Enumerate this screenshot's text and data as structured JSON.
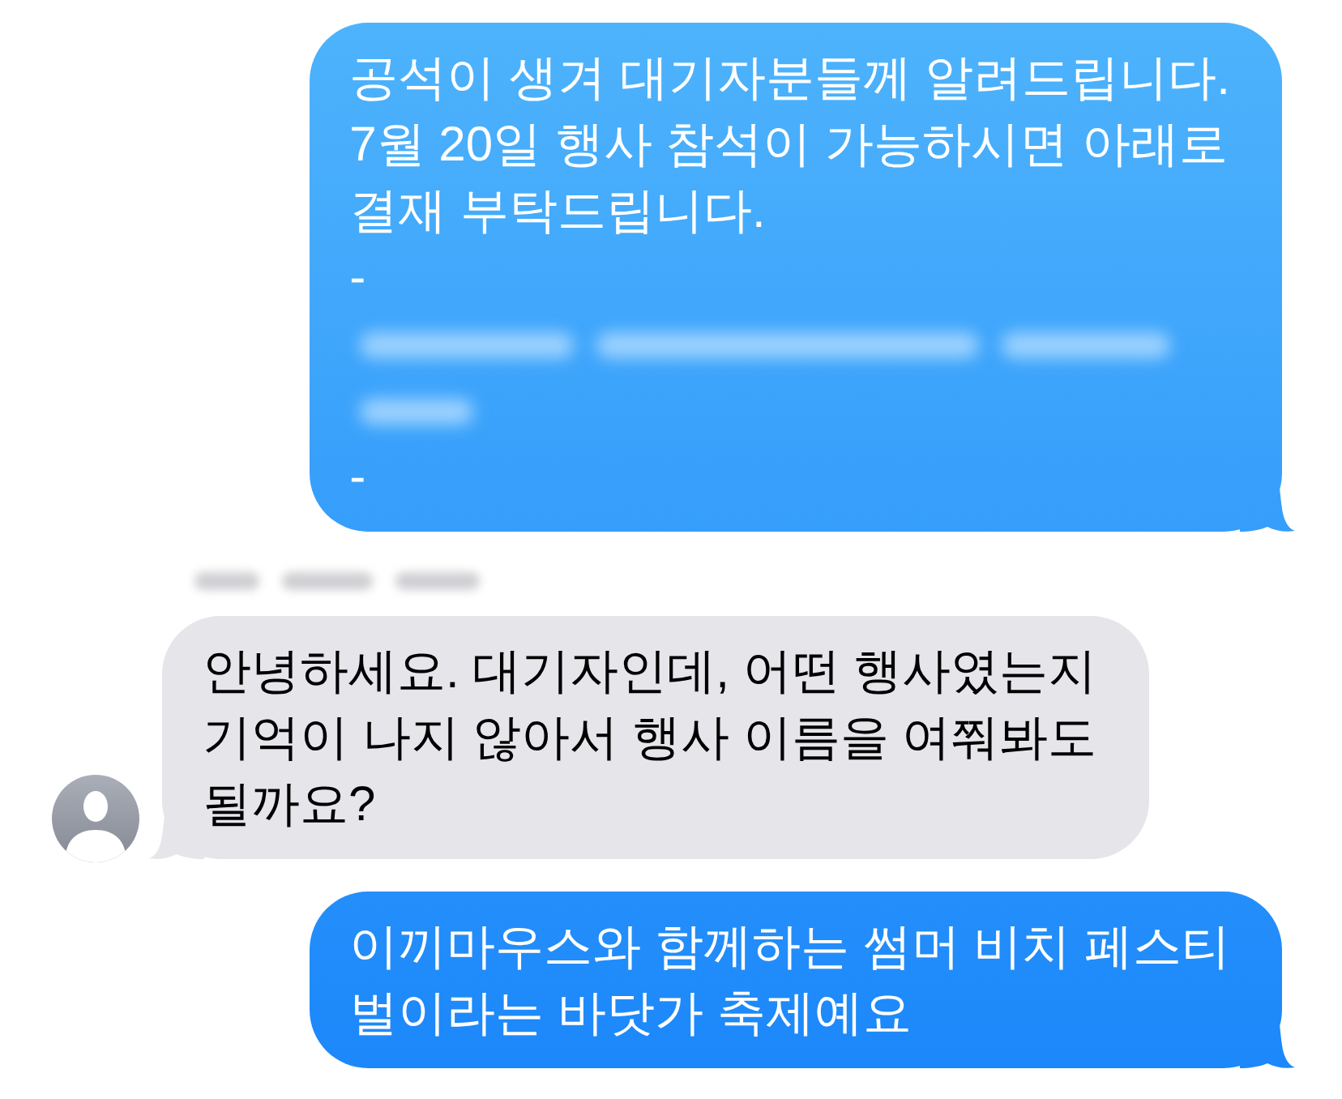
{
  "messages": [
    {
      "kind": "sent",
      "parts": [
        {
          "kind": "text",
          "text": "공석이 생겨 대기자분들께 알려드립니다.\n7월 20일 행사 참석이 가능하시면 아래로\n결재 부탁드립니다."
        },
        {
          "kind": "text",
          "text": "-"
        },
        {
          "kind": "redacted"
        },
        {
          "kind": "text",
          "text": "-"
        }
      ]
    },
    {
      "kind": "received",
      "sender_name_blurred": true,
      "parts": [
        {
          "kind": "text",
          "text": "안녕하세요. 대기자인데, 어떤 행사였는지\n기억이 나지 않아서 행사 이름을 여쭤봐도\n될까요?"
        }
      ]
    },
    {
      "kind": "sent",
      "parts": [
        {
          "kind": "text",
          "text": "이끼마우스와 함께하는 썸머 비치 페스티\n벌이라는 바닷가 축제예요"
        }
      ]
    }
  ]
}
